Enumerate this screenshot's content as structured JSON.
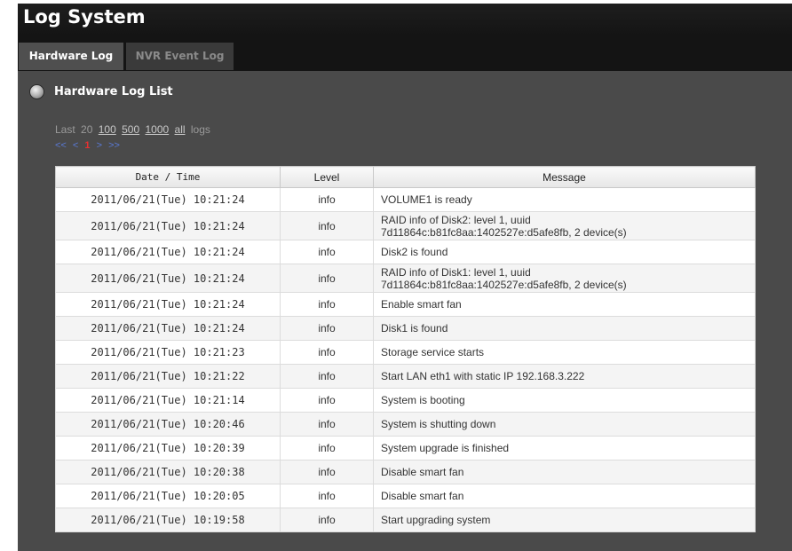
{
  "window": {
    "title": "Log System"
  },
  "tabs": [
    {
      "label": "Hardware Log"
    },
    {
      "label": "NVR Event Log"
    }
  ],
  "section": {
    "title": "Hardware Log List"
  },
  "log_options": {
    "prefix": "Last",
    "current": "20",
    "options": [
      "100",
      "500",
      "1000",
      "all"
    ],
    "suffix": "logs"
  },
  "pagination": {
    "first": "<<",
    "prev": "<",
    "page": "1",
    "next": ">",
    "last": ">>"
  },
  "table": {
    "headers": [
      "Date / Time",
      "Level",
      "Message"
    ],
    "rows": [
      {
        "datetime": "2011/06/21(Tue) 10:21:24",
        "level": "info",
        "message": [
          "VOLUME1 is ready"
        ]
      },
      {
        "datetime": "2011/06/21(Tue) 10:21:24",
        "level": "info",
        "message": [
          "RAID info of Disk2: level 1, uuid",
          "7d11864c:b81fc8aa:1402527e:d5afe8fb, 2 device(s)"
        ]
      },
      {
        "datetime": "2011/06/21(Tue) 10:21:24",
        "level": "info",
        "message": [
          "Disk2 is found"
        ]
      },
      {
        "datetime": "2011/06/21(Tue) 10:21:24",
        "level": "info",
        "message": [
          "RAID info of Disk1: level 1, uuid",
          "7d11864c:b81fc8aa:1402527e:d5afe8fb, 2 device(s)"
        ]
      },
      {
        "datetime": "2011/06/21(Tue) 10:21:24",
        "level": "info",
        "message": [
          "Enable smart fan"
        ]
      },
      {
        "datetime": "2011/06/21(Tue) 10:21:24",
        "level": "info",
        "message": [
          "Disk1 is found"
        ]
      },
      {
        "datetime": "2011/06/21(Tue) 10:21:23",
        "level": "info",
        "message": [
          "Storage service starts"
        ]
      },
      {
        "datetime": "2011/06/21(Tue) 10:21:22",
        "level": "info",
        "message": [
          "Start LAN eth1 with static IP 192.168.3.222"
        ]
      },
      {
        "datetime": "2011/06/21(Tue) 10:21:14",
        "level": "info",
        "message": [
          "System is booting"
        ]
      },
      {
        "datetime": "2011/06/21(Tue) 10:20:46",
        "level": "info",
        "message": [
          "System is shutting down"
        ]
      },
      {
        "datetime": "2011/06/21(Tue) 10:20:39",
        "level": "info",
        "message": [
          "System upgrade is finished"
        ]
      },
      {
        "datetime": "2011/06/21(Tue) 10:20:38",
        "level": "info",
        "message": [
          "Disable smart fan"
        ]
      },
      {
        "datetime": "2011/06/21(Tue) 10:20:05",
        "level": "info",
        "message": [
          "Disable smart fan"
        ]
      },
      {
        "datetime": "2011/06/21(Tue) 10:19:58",
        "level": "info",
        "message": [
          "Start upgrading system"
        ]
      }
    ]
  }
}
